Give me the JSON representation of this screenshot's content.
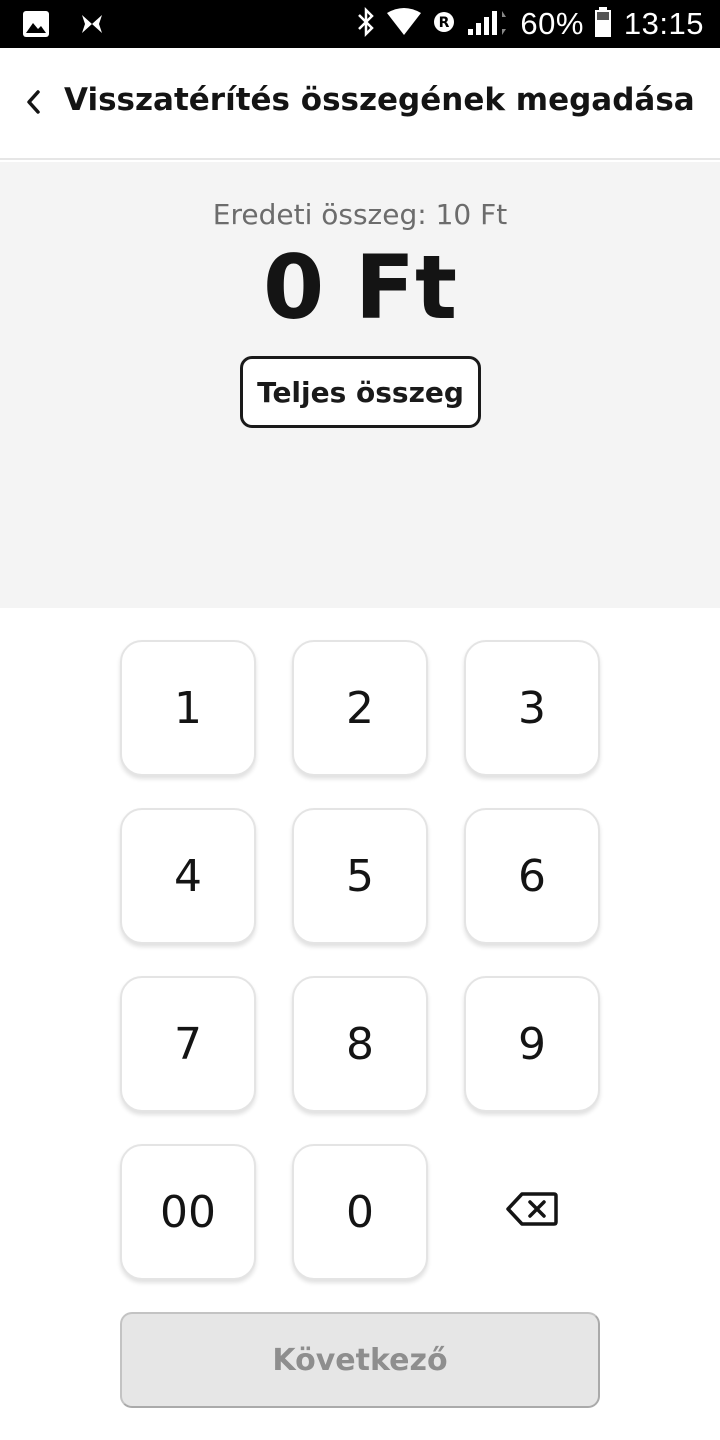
{
  "status_bar": {
    "icons_left": [
      "image-icon",
      "app-notification-icon"
    ],
    "icons_right": [
      "bluetooth-icon",
      "wifi-icon",
      "roaming-icon",
      "signal-icon"
    ],
    "battery_percent": "60%",
    "time": "13:15"
  },
  "app_bar": {
    "title": "Visszatérítés összegének megadása"
  },
  "amount": {
    "original": "Eredeti összeg: 10 Ft",
    "current": "0 Ft",
    "full_amount_label": "Teljes összeg"
  },
  "keypad": {
    "keys": [
      "1",
      "2",
      "3",
      "4",
      "5",
      "6",
      "7",
      "8",
      "9",
      "00",
      "0"
    ],
    "backspace_icon": "backspace-icon"
  },
  "next_button": {
    "label": "Következő",
    "enabled": false
  },
  "colors": {
    "panel_bg": "#f4f4f4",
    "disabled_button_bg": "#e6e6e6",
    "disabled_text": "#8e8e8e",
    "text": "#141414"
  }
}
